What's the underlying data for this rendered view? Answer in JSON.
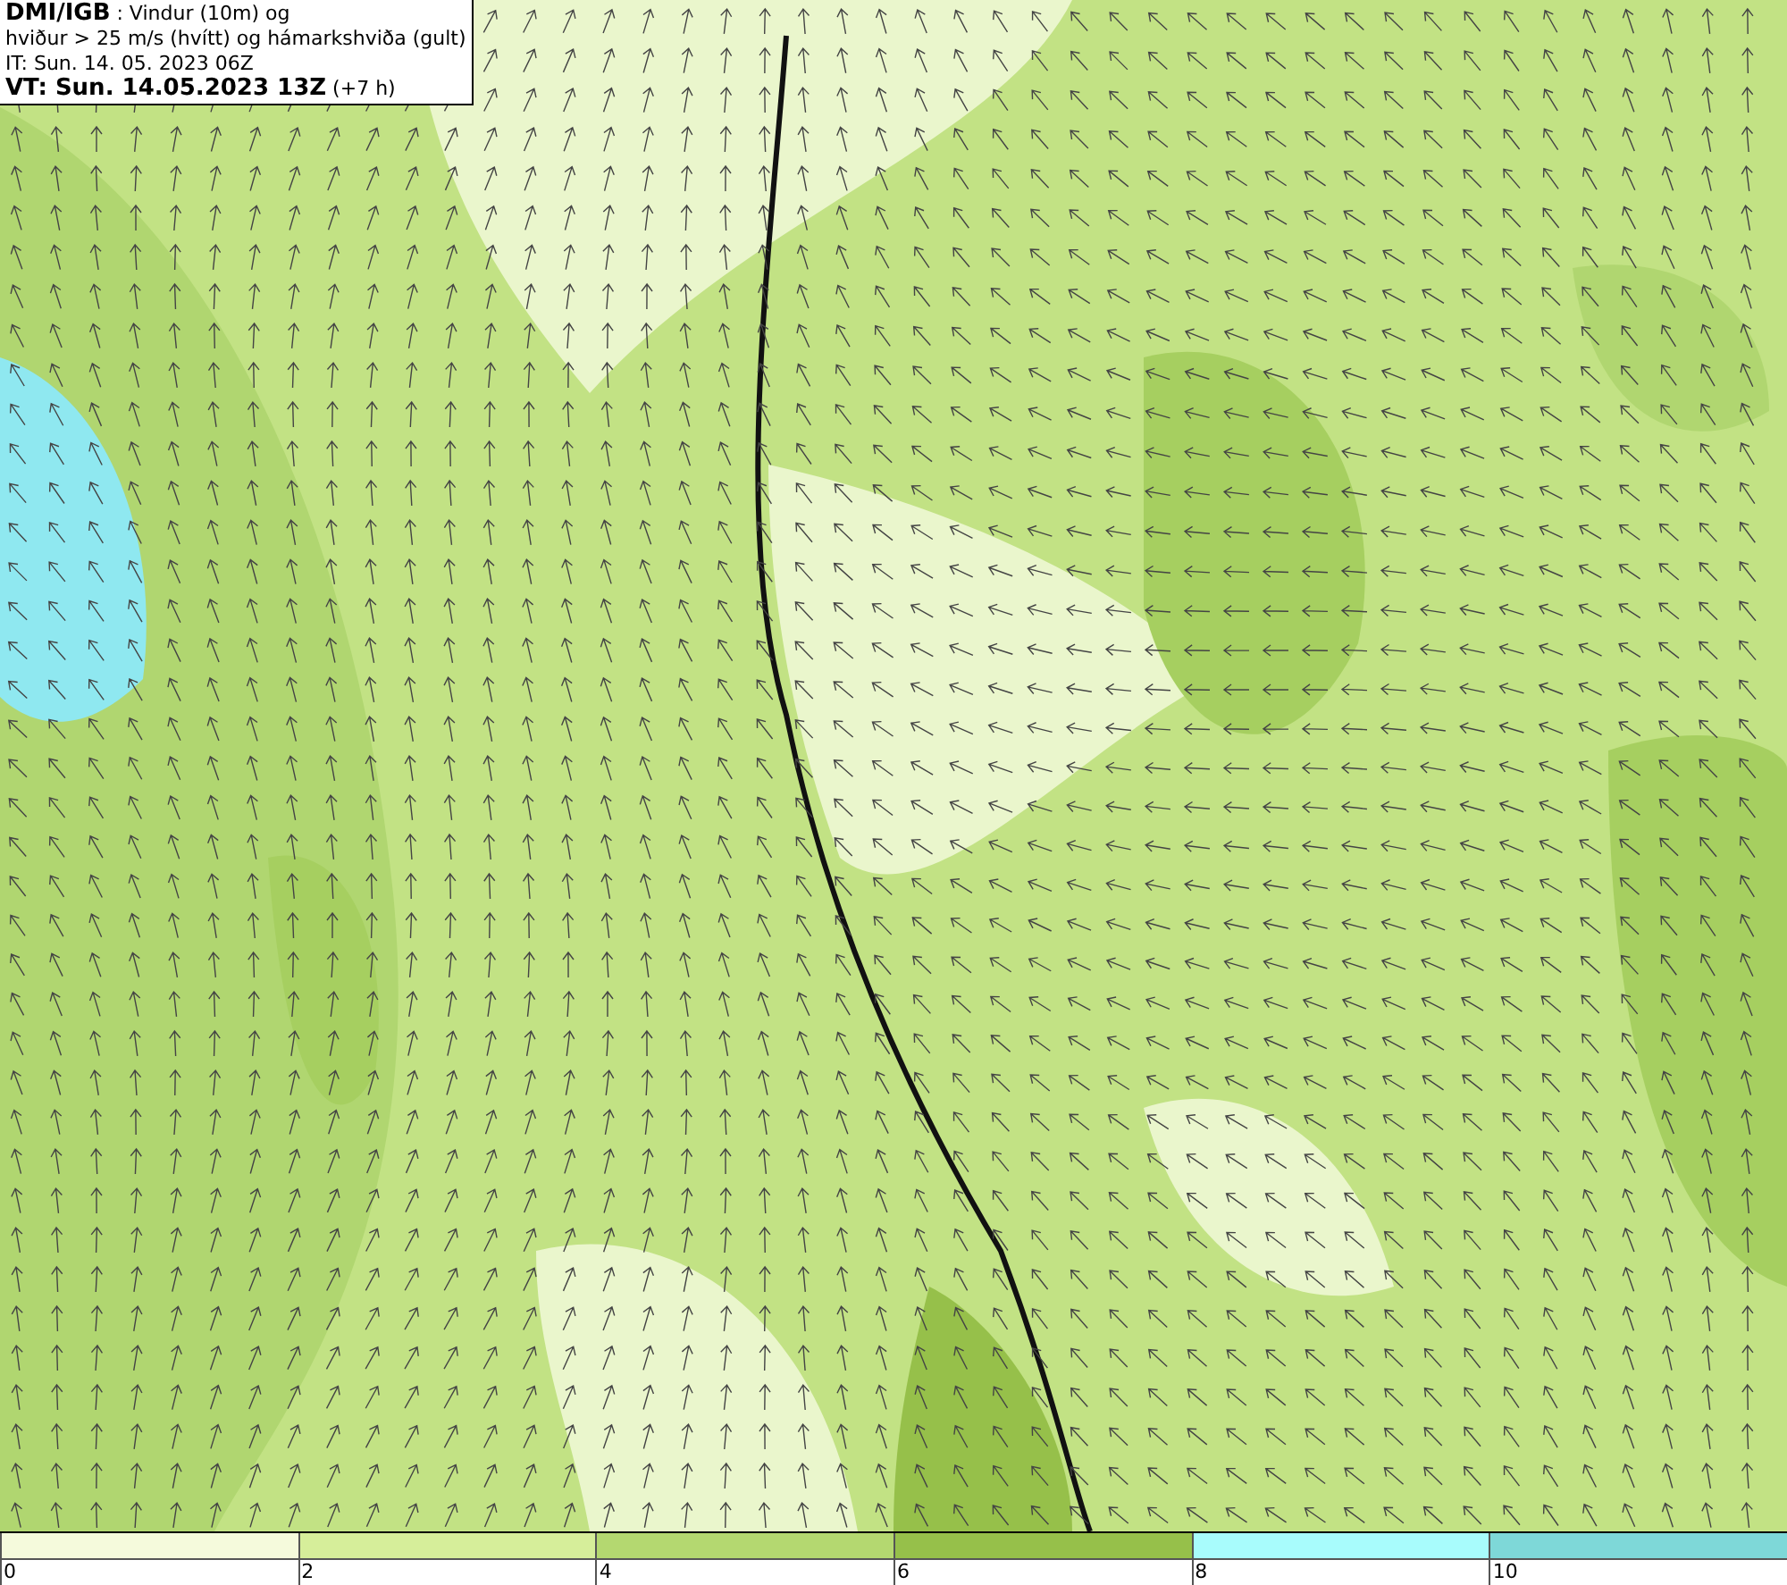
{
  "header": {
    "lines": [
      "**DMI/IGB** : Vindur (10m) og",
      "hviður > 25 m/s (hvítt) og hámarkshviða (gult)",
      "IT: Sun. 14. 05. 2023 06Z",
      "**VT: Sun. 14.05.2023 13Z** (+7 h)"
    ]
  },
  "legend": [
    {
      "color": "#f5fadc",
      "label": "0"
    },
    {
      "color": "#d6ee9a",
      "label": "2"
    },
    {
      "color": "#b4d870",
      "label": "4"
    },
    {
      "color": "#96c04a",
      "label": "6"
    },
    {
      "color": "#a8fcfc",
      "label": "8"
    },
    {
      "color": "#7ed8d8",
      "label": "10"
    }
  ]
}
